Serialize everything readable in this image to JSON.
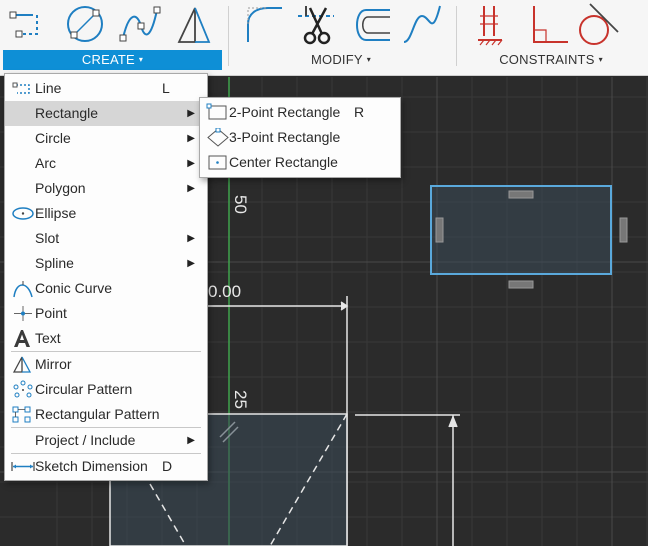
{
  "toolbar": {
    "groups": {
      "create": {
        "label": "CREATE"
      },
      "modify": {
        "label": "MODIFY"
      },
      "constraints": {
        "label": "CONSTRAINTS"
      }
    },
    "caret": "▾"
  },
  "create_menu": {
    "items": [
      {
        "label": "Line",
        "shortcut": "L",
        "icon": "line-icon"
      },
      {
        "label": "Rectangle",
        "icon": "",
        "has_submenu": true
      },
      {
        "label": "Circle",
        "icon": "",
        "has_submenu": true
      },
      {
        "label": "Arc",
        "icon": "",
        "has_submenu": true
      },
      {
        "label": "Polygon",
        "icon": "",
        "has_submenu": true
      },
      {
        "label": "Ellipse",
        "icon": "ellipse-icon"
      },
      {
        "label": "Slot",
        "icon": "",
        "has_submenu": true
      },
      {
        "label": "Spline",
        "icon": "",
        "has_submenu": true
      },
      {
        "label": "Conic Curve",
        "icon": "conic-curve-icon"
      },
      {
        "label": "Point",
        "icon": "point-icon"
      },
      {
        "label": "Text",
        "icon": "text-icon"
      },
      {
        "label": "Mirror",
        "icon": "mirror-icon"
      },
      {
        "label": "Circular Pattern",
        "icon": "circular-pattern-icon"
      },
      {
        "label": "Rectangular Pattern",
        "icon": "rectangular-pattern-icon"
      },
      {
        "label": "Project / Include",
        "icon": "",
        "has_submenu": true
      },
      {
        "label": "Sketch Dimension",
        "shortcut": "D",
        "icon": "sketch-dimension-icon"
      }
    ],
    "submenu_arrow": "▶"
  },
  "rectangle_submenu": {
    "items": [
      {
        "label": "2-Point Rectangle",
        "shortcut": "R",
        "icon": "two-point-rectangle-icon"
      },
      {
        "label": "3-Point Rectangle",
        "icon": "three-point-rectangle-icon"
      },
      {
        "label": "Center Rectangle",
        "icon": "center-rectangle-icon"
      }
    ]
  },
  "canvas": {
    "dimension_labels": {
      "vertical_50": "50",
      "horizontal_partial": "0.00",
      "vertical_25": "25"
    }
  },
  "colors": {
    "accent": "#0e8fd6",
    "constraint_red": "#c8332c",
    "sketch_blue": "#5aa9dc",
    "canvas": "#2b2b2b",
    "axis_green": "#3fa34d"
  }
}
